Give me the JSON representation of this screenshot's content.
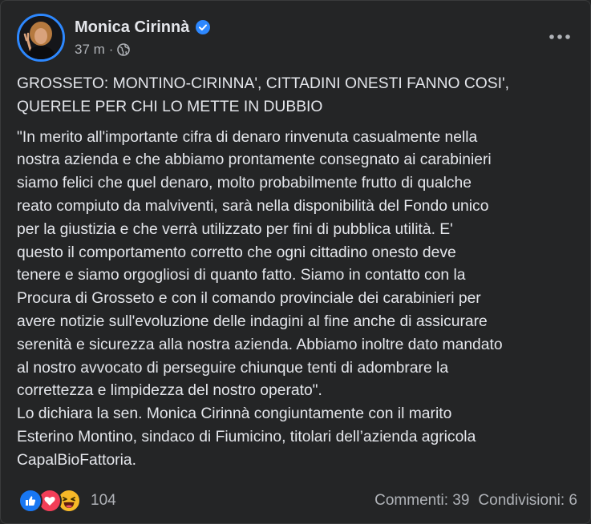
{
  "post": {
    "author_name": "Monica Cirinnà",
    "verified": true,
    "timestamp": "37 m",
    "separator": "·",
    "privacy_icon": "globe-icon",
    "more_icon": "more-horizontal-icon",
    "body": {
      "headline_lines": [
        "GROSSETO: MONTINO-CIRINNA', CITTADINI ONESTI FANNO COSI',",
        "QUERELE PER CHI LO METTE IN DUBBIO"
      ],
      "paragraph_lines": [
        "\"In merito all'importante cifra di denaro rinvenuta casualmente nella",
        "nostra azienda e che abbiamo prontamente consegnato ai carabinieri",
        "siamo felici che quel denaro, molto probabilmente frutto di qualche",
        "reato compiuto da malviventi, sarà nella disponibilità del Fondo unico",
        "per la giustizia e che verrà utilizzato per fini di pubblica utilità. E'",
        "questo il comportamento corretto che ogni cittadino onesto deve",
        "tenere e siamo orgogliosi di quanto fatto. Siamo in contatto con la",
        "Procura di Grosseto e con il comando provinciale dei carabinieri per",
        "avere notizie sull'evoluzione delle indagini al fine anche di assicurare",
        "serenità e sicurezza alla nostra azienda. Abbiamo inoltre dato mandato",
        "al nostro avvocato di perseguire chiunque tenti di adombrare la",
        "correttezza e limpidezza del nostro operato\".",
        "Lo dichiara la sen. Monica Cirinnà congiuntamente con il marito",
        "Esterino Montino, sindaco di Fiumicino, titolari dell’azienda agricola",
        "CapalBioFattoria."
      ]
    },
    "reactions": {
      "icons": [
        "like-icon",
        "love-icon",
        "haha-icon"
      ],
      "count": "104"
    },
    "stats": {
      "comments": "Commenti: 39",
      "shares": "Condivisioni: 6"
    },
    "colors": {
      "background": "#242526",
      "text": "#e4e6eb",
      "secondary_text": "#b0b3b8",
      "verified_blue": "#2d88ff",
      "like_blue": "#1877f2",
      "love_red": "#f33e58",
      "haha_yellow": "#f7b928"
    }
  }
}
